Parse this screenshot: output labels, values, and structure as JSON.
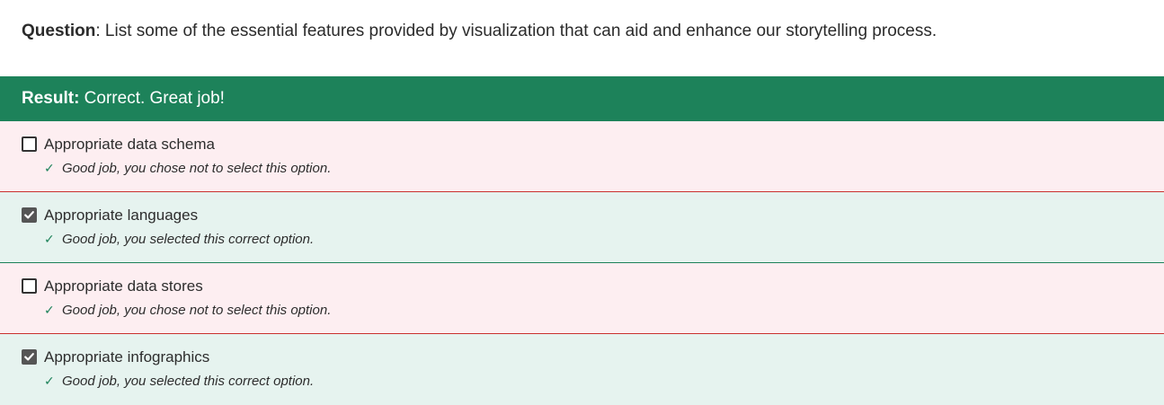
{
  "question": {
    "label": "Question",
    "text": ": List some of the essential features provided by visualization that can aid and enhance our storytelling process."
  },
  "result": {
    "label": "Result:",
    "text": " Correct. Great job!",
    "color": "#1d825a"
  },
  "options": [
    {
      "label": "Appropriate data schema",
      "checked": false,
      "feedback": "Good job, you chose not to select this option.",
      "feedback_icon": "checkmark-icon",
      "background": "#fdeef1",
      "border": "#c9312e"
    },
    {
      "label": "Appropriate languages",
      "checked": true,
      "feedback": "Good job, you selected this correct option.",
      "feedback_icon": "checkmark-icon",
      "background": "#e6f3ef",
      "border": "#1d825a"
    },
    {
      "label": "Appropriate data stores",
      "checked": false,
      "feedback": "Good job, you chose not to select this option.",
      "feedback_icon": "checkmark-icon",
      "background": "#fdeef1",
      "border": "#c9312e"
    },
    {
      "label": "Appropriate infographics",
      "checked": true,
      "feedback": "Good job, you selected this correct option.",
      "feedback_icon": "checkmark-icon",
      "background": "#e6f3ef",
      "border": "#1d825a"
    }
  ]
}
